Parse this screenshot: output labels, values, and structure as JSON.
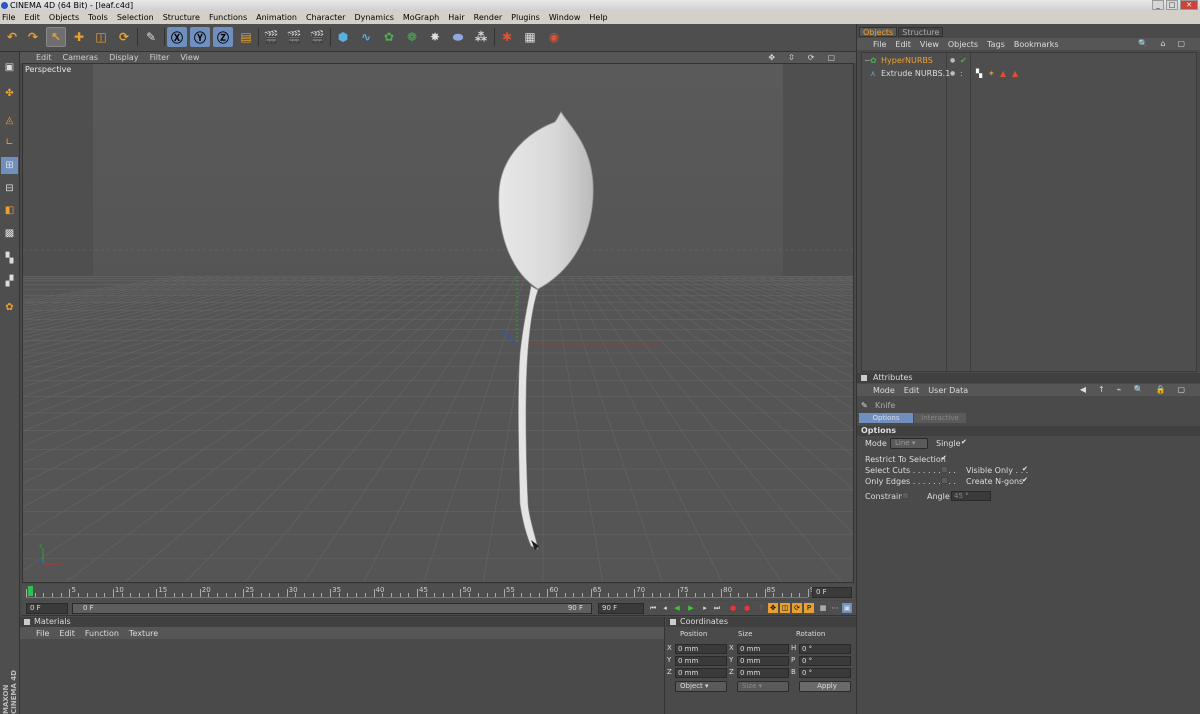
{
  "app": {
    "title": "CINEMA 4D (64 Bit) - [leaf.c4d]"
  },
  "menu": [
    "File",
    "Edit",
    "Objects",
    "Tools",
    "Selection",
    "Structure",
    "Functions",
    "Animation",
    "Character",
    "Dynamics",
    "MoGraph",
    "Hair",
    "Render",
    "Plugins",
    "Window",
    "Help"
  ],
  "viewport": {
    "menu": [
      "Edit",
      "Cameras",
      "Display",
      "Filter",
      "View"
    ],
    "label": "Perspective"
  },
  "timeline": {
    "ticks": [
      "0",
      "5",
      "10",
      "15",
      "20",
      "25",
      "30",
      "35",
      "40",
      "45",
      "50",
      "55",
      "60",
      "65",
      "70",
      "75",
      "80",
      "85",
      "90"
    ],
    "current_frame": "0 F",
    "start_field": "0 F",
    "slider_start": "0 F",
    "slider_end": "90 F",
    "end_field": "90 F"
  },
  "materials": {
    "title": "Materials",
    "menu": [
      "File",
      "Edit",
      "Function",
      "Texture"
    ]
  },
  "coordinates": {
    "title": "Coordinates",
    "headers": [
      "Position",
      "Size",
      "Rotation"
    ],
    "rows": [
      {
        "pos_axis": "X",
        "pos": "0 mm",
        "size_axis": "X",
        "size": "0 mm",
        "rot_axis": "H",
        "rot": "0 °"
      },
      {
        "pos_axis": "Y",
        "pos": "0 mm",
        "size_axis": "Y",
        "size": "0 mm",
        "rot_axis": "P",
        "rot": "0 °"
      },
      {
        "pos_axis": "Z",
        "pos": "0 mm",
        "size_axis": "Z",
        "size": "0 mm",
        "rot_axis": "B",
        "rot": "0 °"
      }
    ],
    "mode_select": "Object",
    "size_select": "Size",
    "apply_label": "Apply"
  },
  "objects_panel": {
    "tabs": [
      "Objects",
      "Structure"
    ],
    "menu": [
      "File",
      "Edit",
      "View",
      "Objects",
      "Tags",
      "Bookmarks"
    ],
    "items": [
      {
        "name": "HyperNURBS",
        "color": "#f0a030"
      },
      {
        "name": "Extrude NURBS.1",
        "color": "#dddddd"
      }
    ]
  },
  "attributes": {
    "title": "Attributes",
    "menu": [
      "Mode",
      "Edit",
      "User Data"
    ],
    "tool_name": "Knife",
    "tabs": [
      "Options",
      "Interactive"
    ],
    "section": "Options",
    "mode_label": "Mode",
    "mode_value": "Line",
    "single_label": "Single",
    "restrict_label": "Restrict To Selection",
    "select_cuts_label": "Select Cuts",
    "visible_only_label": "Visible Only",
    "only_edges_label": "Only Edges",
    "create_ngons_label": "Create N-gons",
    "constrain_label": "Constrain",
    "angle_label": "Angle",
    "angle_value": "45 °"
  },
  "branding": {
    "vertical": "MAXON CINEMA 4D"
  },
  "colors": {
    "accent": "#f0a030",
    "selected_tab": "#6f8fbf",
    "bg": "#4a4a4a"
  }
}
